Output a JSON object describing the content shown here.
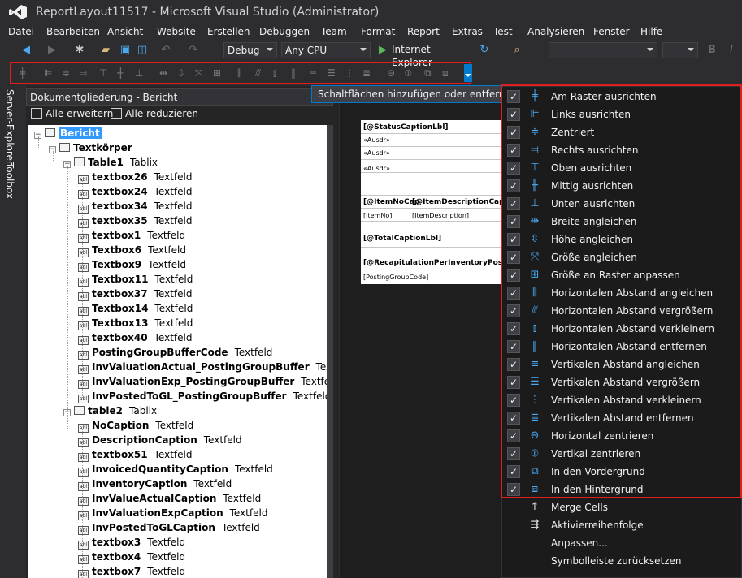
{
  "window": {
    "title": "ReportLayout11517 - Microsoft Visual Studio (Administrator)"
  },
  "menu": [
    "Datei",
    "Bearbeiten",
    "Ansicht",
    "Website",
    "Erstellen",
    "Debuggen",
    "Team",
    "Format",
    "Report",
    "Extras",
    "Test",
    "Analysieren",
    "Fenster",
    "Hilfe"
  ],
  "toolbar": {
    "configuration": "Debug",
    "platform": "Any CPU",
    "run_target": "Internet Explorer"
  },
  "side_tabs": [
    "Server-Explorer",
    "Toolbox"
  ],
  "outline": {
    "title": "Dokumentgliederung - Bericht",
    "expand_all": "Alle erweitern",
    "collapse_all": "Alle reduzieren",
    "tree": [
      {
        "name": "Bericht",
        "type": "",
        "icon": "report-icon"
      },
      {
        "name": "Textkörper",
        "type": "",
        "icon": "body-icon"
      },
      {
        "name": "Table1",
        "type": "Tablix",
        "icon": "table-icon"
      },
      {
        "name": "textbox26",
        "type": "Textfeld",
        "icon": "textbox-icon"
      },
      {
        "name": "textbox24",
        "type": "Textfeld",
        "icon": "textbox-icon"
      },
      {
        "name": "textbox34",
        "type": "Textfeld",
        "icon": "textbox-icon"
      },
      {
        "name": "textbox35",
        "type": "Textfeld",
        "icon": "textbox-icon"
      },
      {
        "name": "textbox1",
        "type": "Textfeld",
        "icon": "textbox-icon"
      },
      {
        "name": "Textbox6",
        "type": "Textfeld",
        "icon": "textbox-icon"
      },
      {
        "name": "Textbox9",
        "type": "Textfeld",
        "icon": "textbox-icon"
      },
      {
        "name": "Textbox11",
        "type": "Textfeld",
        "icon": "textbox-icon"
      },
      {
        "name": "textbox37",
        "type": "Textfeld",
        "icon": "textbox-icon"
      },
      {
        "name": "Textbox14",
        "type": "Textfeld",
        "icon": "textbox-icon"
      },
      {
        "name": "Textbox13",
        "type": "Textfeld",
        "icon": "textbox-icon"
      },
      {
        "name": "textbox40",
        "type": "Textfeld",
        "icon": "textbox-icon"
      },
      {
        "name": "PostingGroupBufferCode",
        "type": "Textfeld",
        "icon": "textbox-icon"
      },
      {
        "name": "InvValuationActual_PostingGroupBuffer",
        "type": "Textf",
        "icon": "textbox-icon"
      },
      {
        "name": "InvValuationExp_PostingGroupBuffer",
        "type": "Textfeld",
        "icon": "textbox-icon"
      },
      {
        "name": "InvPostedToGL_PostingGroupBuffer",
        "type": "Textfeld",
        "icon": "textbox-icon"
      },
      {
        "name": "table2",
        "type": "Tablix",
        "icon": "table-icon"
      },
      {
        "name": "NoCaption",
        "type": "Textfeld",
        "icon": "textbox-icon"
      },
      {
        "name": "DescriptionCaption",
        "type": "Textfeld",
        "icon": "textbox-icon"
      },
      {
        "name": "textbox51",
        "type": "Textfeld",
        "icon": "textbox-icon"
      },
      {
        "name": "InvoicedQuantityCaption",
        "type": "Textfeld",
        "icon": "textbox-icon"
      },
      {
        "name": "InventoryCaption",
        "type": "Textfeld",
        "icon": "textbox-icon"
      },
      {
        "name": "InvValueActualCaption",
        "type": "Textfeld",
        "icon": "textbox-icon"
      },
      {
        "name": "InvValuationExpCaption",
        "type": "Textfeld",
        "icon": "textbox-icon"
      },
      {
        "name": "InvPostedToGLCaption",
        "type": "Textfeld",
        "icon": "textbox-icon"
      },
      {
        "name": "textbox3",
        "type": "Textfeld",
        "icon": "textbox-icon"
      },
      {
        "name": "textbox4",
        "type": "Textfeld",
        "icon": "textbox-icon"
      },
      {
        "name": "textbox7",
        "type": "Textfeld",
        "icon": "textbox-icon"
      }
    ],
    "expander_symbol": "−",
    "textbox_glyph": "abl"
  },
  "designer": {
    "customize_button": "Schaltflächen hinzufügen oder entfernen",
    "report_cells": [
      "[@StatusCaptionLbl]",
      "«Ausdr»",
      "«Ausdr»",
      "«Ausdr»",
      "[@ItemNoCap",
      "[@ItemDescriptionCaptio",
      "[ItemNo]",
      "[ItemDescription]",
      "[@TotalCaptionLbl]",
      "[@RecapitulationPerInventoryPosting",
      "[PostingGroupCode]"
    ]
  },
  "dropdown": {
    "checked_items": [
      {
        "label": "Am Raster ausrichten",
        "icon": "align-to-grid-icon",
        "glyph": "╪",
        "checked": true
      },
      {
        "label": "Links ausrichten",
        "icon": "align-left-icon",
        "glyph": "⊫",
        "checked": true
      },
      {
        "label": "Zentriert",
        "icon": "align-center-icon",
        "glyph": "≑",
        "checked": true
      },
      {
        "label": "Rechts ausrichten",
        "icon": "align-right-icon",
        "glyph": "⫤",
        "checked": true
      },
      {
        "label": "Oben ausrichten",
        "icon": "align-top-icon",
        "glyph": "⊤",
        "checked": true
      },
      {
        "label": "Mittig ausrichten",
        "icon": "align-middle-icon",
        "glyph": "╫",
        "checked": true
      },
      {
        "label": "Unten ausrichten",
        "icon": "align-bottom-icon",
        "glyph": "⊥",
        "checked": true
      },
      {
        "label": "Breite angleichen",
        "icon": "same-width-icon",
        "glyph": "⇹",
        "checked": true
      },
      {
        "label": "Höhe angleichen",
        "icon": "same-height-icon",
        "glyph": "⇳",
        "checked": true
      },
      {
        "label": "Größe angleichen",
        "icon": "same-size-icon",
        "glyph": "⤧",
        "checked": true
      },
      {
        "label": "Größe an Raster anpassen",
        "icon": "size-to-grid-icon",
        "glyph": "⊞",
        "checked": true
      },
      {
        "label": "Horizontalen Abstand angleichen",
        "icon": "hspace-equal-icon",
        "glyph": "⫼",
        "checked": true
      },
      {
        "label": "Horizontalen Abstand vergrößern",
        "icon": "hspace-increase-icon",
        "glyph": "⫻",
        "checked": true
      },
      {
        "label": "Horizontalen Abstand verkleinern",
        "icon": "hspace-decrease-icon",
        "glyph": "⫾",
        "checked": true
      },
      {
        "label": "Horizontalen Abstand entfernen",
        "icon": "hspace-remove-icon",
        "glyph": "‖",
        "checked": true
      },
      {
        "label": "Vertikalen Abstand angleichen",
        "icon": "vspace-equal-icon",
        "glyph": "≡",
        "checked": true
      },
      {
        "label": "Vertikalen Abstand vergrößern",
        "icon": "vspace-increase-icon",
        "glyph": "☰",
        "checked": true
      },
      {
        "label": "Vertikalen Abstand verkleinern",
        "icon": "vspace-decrease-icon",
        "glyph": "⋮",
        "checked": true
      },
      {
        "label": "Vertikalen Abstand entfernen",
        "icon": "vspace-remove-icon",
        "glyph": "≣",
        "checked": true
      },
      {
        "label": "Horizontal zentrieren",
        "icon": "center-horizontal-icon",
        "glyph": "⊖",
        "checked": true
      },
      {
        "label": "Vertikal zentrieren",
        "icon": "center-vertical-icon",
        "glyph": "⦶",
        "checked": true
      },
      {
        "label": "In den Vordergrund",
        "icon": "bring-to-front-icon",
        "glyph": "⧉",
        "checked": true
      },
      {
        "label": "In den Hintergrund",
        "icon": "send-to-back-icon",
        "glyph": "⧈",
        "checked": true
      }
    ],
    "extra_items": [
      {
        "label": "Merge Cells",
        "icon": "merge-cells-icon",
        "glyph": "↑"
      },
      {
        "label": "Aktivierreihenfolge",
        "icon": "tab-order-icon",
        "glyph": "⇶"
      },
      {
        "label": "Anpassen...",
        "icon": "",
        "glyph": ""
      },
      {
        "label": "Symbolleiste zurücksetzen",
        "icon": "",
        "glyph": ""
      }
    ],
    "check_glyph": "✓"
  },
  "colors": {
    "accent": "#007acc",
    "highlight_frame": "#e01e1e",
    "selection": "#3399ff"
  }
}
